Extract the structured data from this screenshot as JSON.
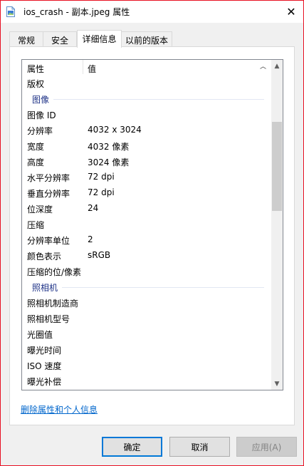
{
  "window": {
    "title": "ios_crash - 副本.jpeg 属性",
    "close_label": "✕",
    "accent_color": "#e81123"
  },
  "tabs": [
    {
      "label": "常规",
      "active": false
    },
    {
      "label": "安全",
      "active": false
    },
    {
      "label": "详细信息",
      "active": true
    },
    {
      "label": "以前的版本",
      "active": false
    }
  ],
  "list": {
    "header": {
      "property": "属性",
      "value": "值"
    },
    "rows": [
      {
        "type": "item",
        "key": "版权",
        "value": ""
      },
      {
        "type": "group",
        "label": "图像"
      },
      {
        "type": "item",
        "key": "图像 ID",
        "value": ""
      },
      {
        "type": "item",
        "key": "分辨率",
        "value": "4032 x 3024"
      },
      {
        "type": "item",
        "key": "宽度",
        "value": "4032 像素"
      },
      {
        "type": "item",
        "key": "高度",
        "value": "3024 像素"
      },
      {
        "type": "item",
        "key": "水平分辨率",
        "value": "72 dpi"
      },
      {
        "type": "item",
        "key": "垂直分辨率",
        "value": "72 dpi"
      },
      {
        "type": "item",
        "key": "位深度",
        "value": "24"
      },
      {
        "type": "item",
        "key": "压缩",
        "value": ""
      },
      {
        "type": "item",
        "key": "分辨率单位",
        "value": "2"
      },
      {
        "type": "item",
        "key": "颜色表示",
        "value": "sRGB"
      },
      {
        "type": "item",
        "key": "压缩的位/像素",
        "value": ""
      },
      {
        "type": "group",
        "label": "照相机"
      },
      {
        "type": "item",
        "key": "照相机制造商",
        "value": ""
      },
      {
        "type": "item",
        "key": "照相机型号",
        "value": ""
      },
      {
        "type": "item",
        "key": "光圈值",
        "value": ""
      },
      {
        "type": "item",
        "key": "曝光时间",
        "value": ""
      },
      {
        "type": "item",
        "key": "ISO 速度",
        "value": ""
      },
      {
        "type": "item",
        "key": "曝光补偿",
        "value": ""
      }
    ]
  },
  "remove_link": "删除属性和个人信息",
  "buttons": {
    "ok": "确定",
    "cancel": "取消",
    "apply": "应用(A)"
  }
}
